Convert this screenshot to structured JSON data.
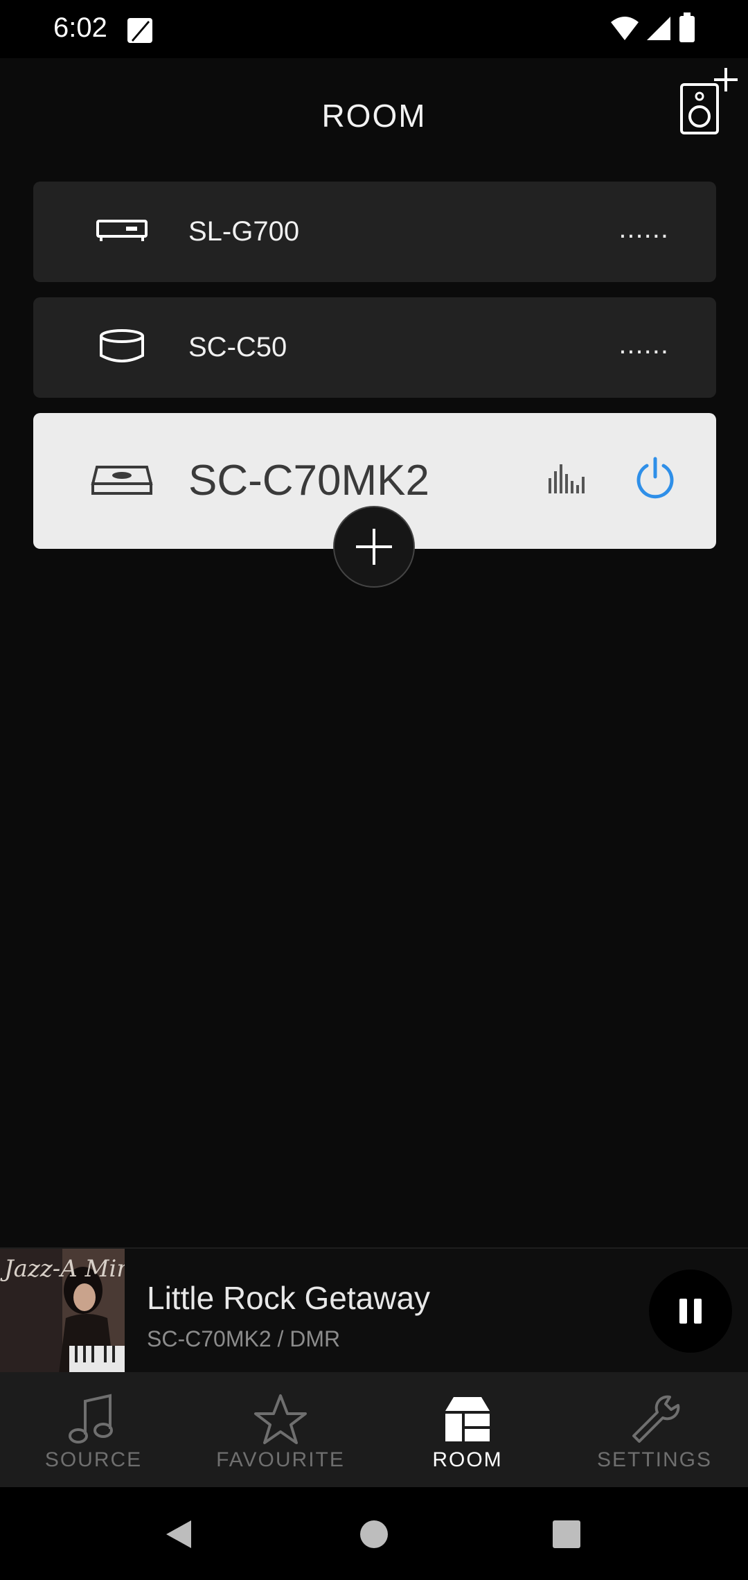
{
  "status_bar": {
    "time": "6:02"
  },
  "header": {
    "title": "ROOM"
  },
  "devices": [
    {
      "name": "SL-G700",
      "more": "......"
    },
    {
      "name": "SC-C50",
      "more": "......"
    },
    {
      "name": "SC-C70MK2"
    }
  ],
  "now_playing": {
    "title": "Little Rock Getaway",
    "subtitle": "SC-C70MK2  / DMR",
    "album_art_text": "Jazz-A Mine"
  },
  "tabs": [
    {
      "label": "SOURCE",
      "icon": "music-note-icon"
    },
    {
      "label": "FAVOURITE",
      "icon": "star-icon"
    },
    {
      "label": "ROOM",
      "icon": "room-icon",
      "active": true
    },
    {
      "label": "SETTINGS",
      "icon": "wrench-icon"
    }
  ],
  "colors": {
    "accent": "#2f8fe8",
    "card_dark": "#222222",
    "card_selected": "#ececec"
  }
}
